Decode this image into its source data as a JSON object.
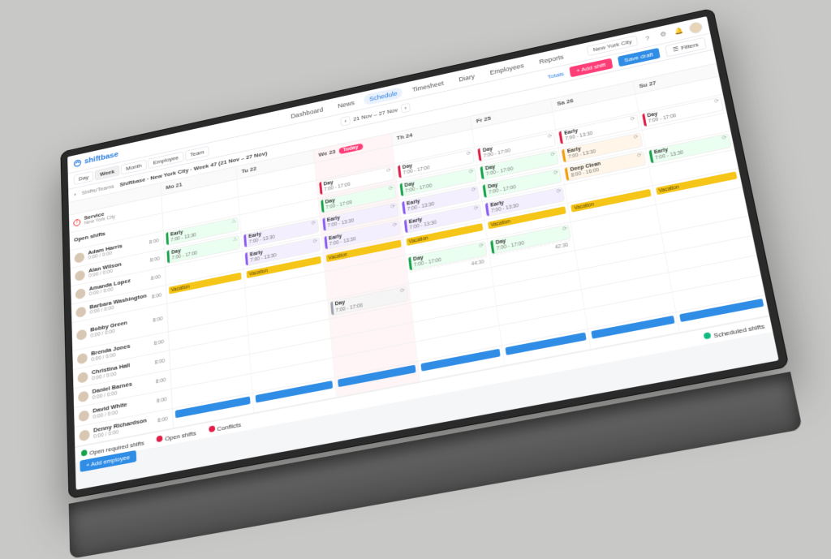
{
  "brand": {
    "name": "shiftbase"
  },
  "top": {
    "location": "New York City",
    "help_icon": "help-icon",
    "settings_icon": "gear-icon",
    "bell_icon": "bell-icon"
  },
  "nav": {
    "items": [
      "Dashboard",
      "News",
      "Schedule",
      "Timesheet",
      "Diary",
      "Employees",
      "Reports"
    ],
    "active": "Schedule"
  },
  "toolbar": {
    "view_modes": [
      "Day",
      "Week",
      "Month",
      "Employee",
      "Team"
    ],
    "view_active": "Week",
    "date_range": "21 Nov – 27 Nov",
    "today_label": "Today",
    "totals_label": "Totals",
    "add_shift_label": "+ Add shift",
    "save_draft_label": "Save draft",
    "filters_label": "Filters"
  },
  "breadcrumb": {
    "root": "Shifts/Teams",
    "title": "Shiftbase · New York City · Week 47 (21 Nov – 27 Nov)"
  },
  "days": [
    {
      "key": "mo",
      "label": "Mo 21",
      "today": false
    },
    {
      "key": "tu",
      "label": "Tu 22",
      "today": false
    },
    {
      "key": "we",
      "label": "We 23",
      "today": true
    },
    {
      "key": "th",
      "label": "Th 24",
      "today": false
    },
    {
      "key": "fr",
      "label": "Fr 25",
      "today": false
    },
    {
      "key": "sa",
      "label": "Sa 26",
      "today": false
    },
    {
      "key": "su",
      "label": "Su 27",
      "today": false
    }
  ],
  "open_shifts": {
    "label": "Open shifts",
    "service_label": "Service",
    "service_sub": "New York City",
    "shifts": [
      {
        "day": "we",
        "title": "Day",
        "time": "7:00 - 17:00"
      },
      {
        "day": "th",
        "title": "Day",
        "time": "7:00 - 17:00"
      },
      {
        "day": "fr",
        "title": "Day",
        "time": "7:00 - 17:00"
      },
      {
        "day": "sa",
        "title": "Early",
        "time": "7:00 - 13:30"
      },
      {
        "day": "su",
        "title": "Day",
        "time": "7:00 - 17:00"
      }
    ]
  },
  "employees": [
    {
      "name": "Adam Harris",
      "hours": "8:00",
      "sub": "0:00 / 0:00",
      "cells": {
        "mo": [
          {
            "t": "Early",
            "time": "7:00 - 13:30",
            "c": "green",
            "warn": true
          }
        ],
        "we": [
          {
            "t": "Day",
            "time": "7:00 - 17:00",
            "c": "green"
          }
        ],
        "th": [
          {
            "t": "Day",
            "time": "7:00 - 17:00",
            "c": "green"
          }
        ],
        "fr": [
          {
            "t": "Day",
            "time": "7:00 - 17:00",
            "c": "green"
          }
        ],
        "sa": [
          {
            "t": "Early",
            "time": "7:00 - 13:30",
            "c": "orange"
          }
        ]
      }
    },
    {
      "name": "Alan Wilson",
      "hours": "8:00",
      "sub": "0:00 / 0:00",
      "cells": {
        "mo": [
          {
            "t": "Day",
            "time": "7:00 - 17:00",
            "c": "green",
            "warn": true
          }
        ],
        "tu": [
          {
            "t": "Early",
            "time": "7:00 - 13:30",
            "c": "purple"
          }
        ],
        "we": [
          {
            "t": "Early",
            "time": "7:00 - 13:30",
            "c": "purple"
          }
        ],
        "th": [
          {
            "t": "Early",
            "time": "7:00 - 13:30",
            "c": "purple"
          }
        ],
        "fr": [
          {
            "t": "Day",
            "time": "7:00 - 17:00",
            "c": "green"
          }
        ],
        "sa": [
          {
            "t": "Deep Clean",
            "time": "8:00 - 16:00",
            "c": "orange"
          }
        ],
        "su": [
          {
            "t": "Early",
            "time": "7:00 - 13:30",
            "c": "green"
          }
        ]
      }
    },
    {
      "name": "Amanda Lopez",
      "hours": "8:00",
      "sub": "0:00 / 0:00",
      "cells": {
        "tu": [
          {
            "t": "Early",
            "time": "7:00 - 13:30",
            "c": "purple"
          }
        ],
        "we": [
          {
            "t": "Early",
            "time": "7:00 - 13:30",
            "c": "purple"
          }
        ],
        "th": [
          {
            "t": "Early",
            "time": "7:00 - 13:30",
            "c": "purple"
          }
        ],
        "fr": [
          {
            "t": "Early",
            "time": "7:00 - 13:30",
            "c": "purple"
          }
        ]
      }
    },
    {
      "name": "Barbara Washington",
      "hours": "8:00",
      "sub": "0:00 / 0:00",
      "absence": {
        "type": "yellow",
        "label": "Vacation"
      }
    },
    {
      "name": "Bobby Green",
      "hours": "8:00",
      "sub": "0:00 / 0:00",
      "summary": {
        "th": "44:30",
        "fr": "42:30"
      },
      "cells": {
        "th": [
          {
            "t": "Day",
            "time": "7:00 - 17:00",
            "c": "green"
          }
        ],
        "fr": [
          {
            "t": "Day",
            "time": "7:00 - 17:00",
            "c": "green"
          }
        ]
      }
    },
    {
      "name": "Brenda Jones",
      "hours": "8:00",
      "sub": "0:00 / 0:00",
      "cells": {
        "we": [
          {
            "t": "Day",
            "time": "7:00 - 17:00",
            "c": "gray"
          }
        ]
      }
    },
    {
      "name": "Christina Hall",
      "hours": "8:00",
      "sub": "0:00 / 0:00",
      "cells": {}
    },
    {
      "name": "Daniel Barnés",
      "hours": "8:00",
      "sub": "0:00 / 0:00",
      "cells": {}
    },
    {
      "name": "David White",
      "hours": "8:00",
      "sub": "0:00 / 0:00",
      "cells": {}
    },
    {
      "name": "Denny Richardson",
      "hours": "8:00",
      "sub": "0:00 / 0:00",
      "absence": {
        "type": "blue",
        "label": ""
      }
    }
  ],
  "legend": {
    "open_required": "Open required shifts",
    "open_shifts": "Open shifts",
    "conflicts": "Conflicts",
    "scheduled": "Scheduled shifts"
  },
  "add_employee_label": "+ Add employee"
}
